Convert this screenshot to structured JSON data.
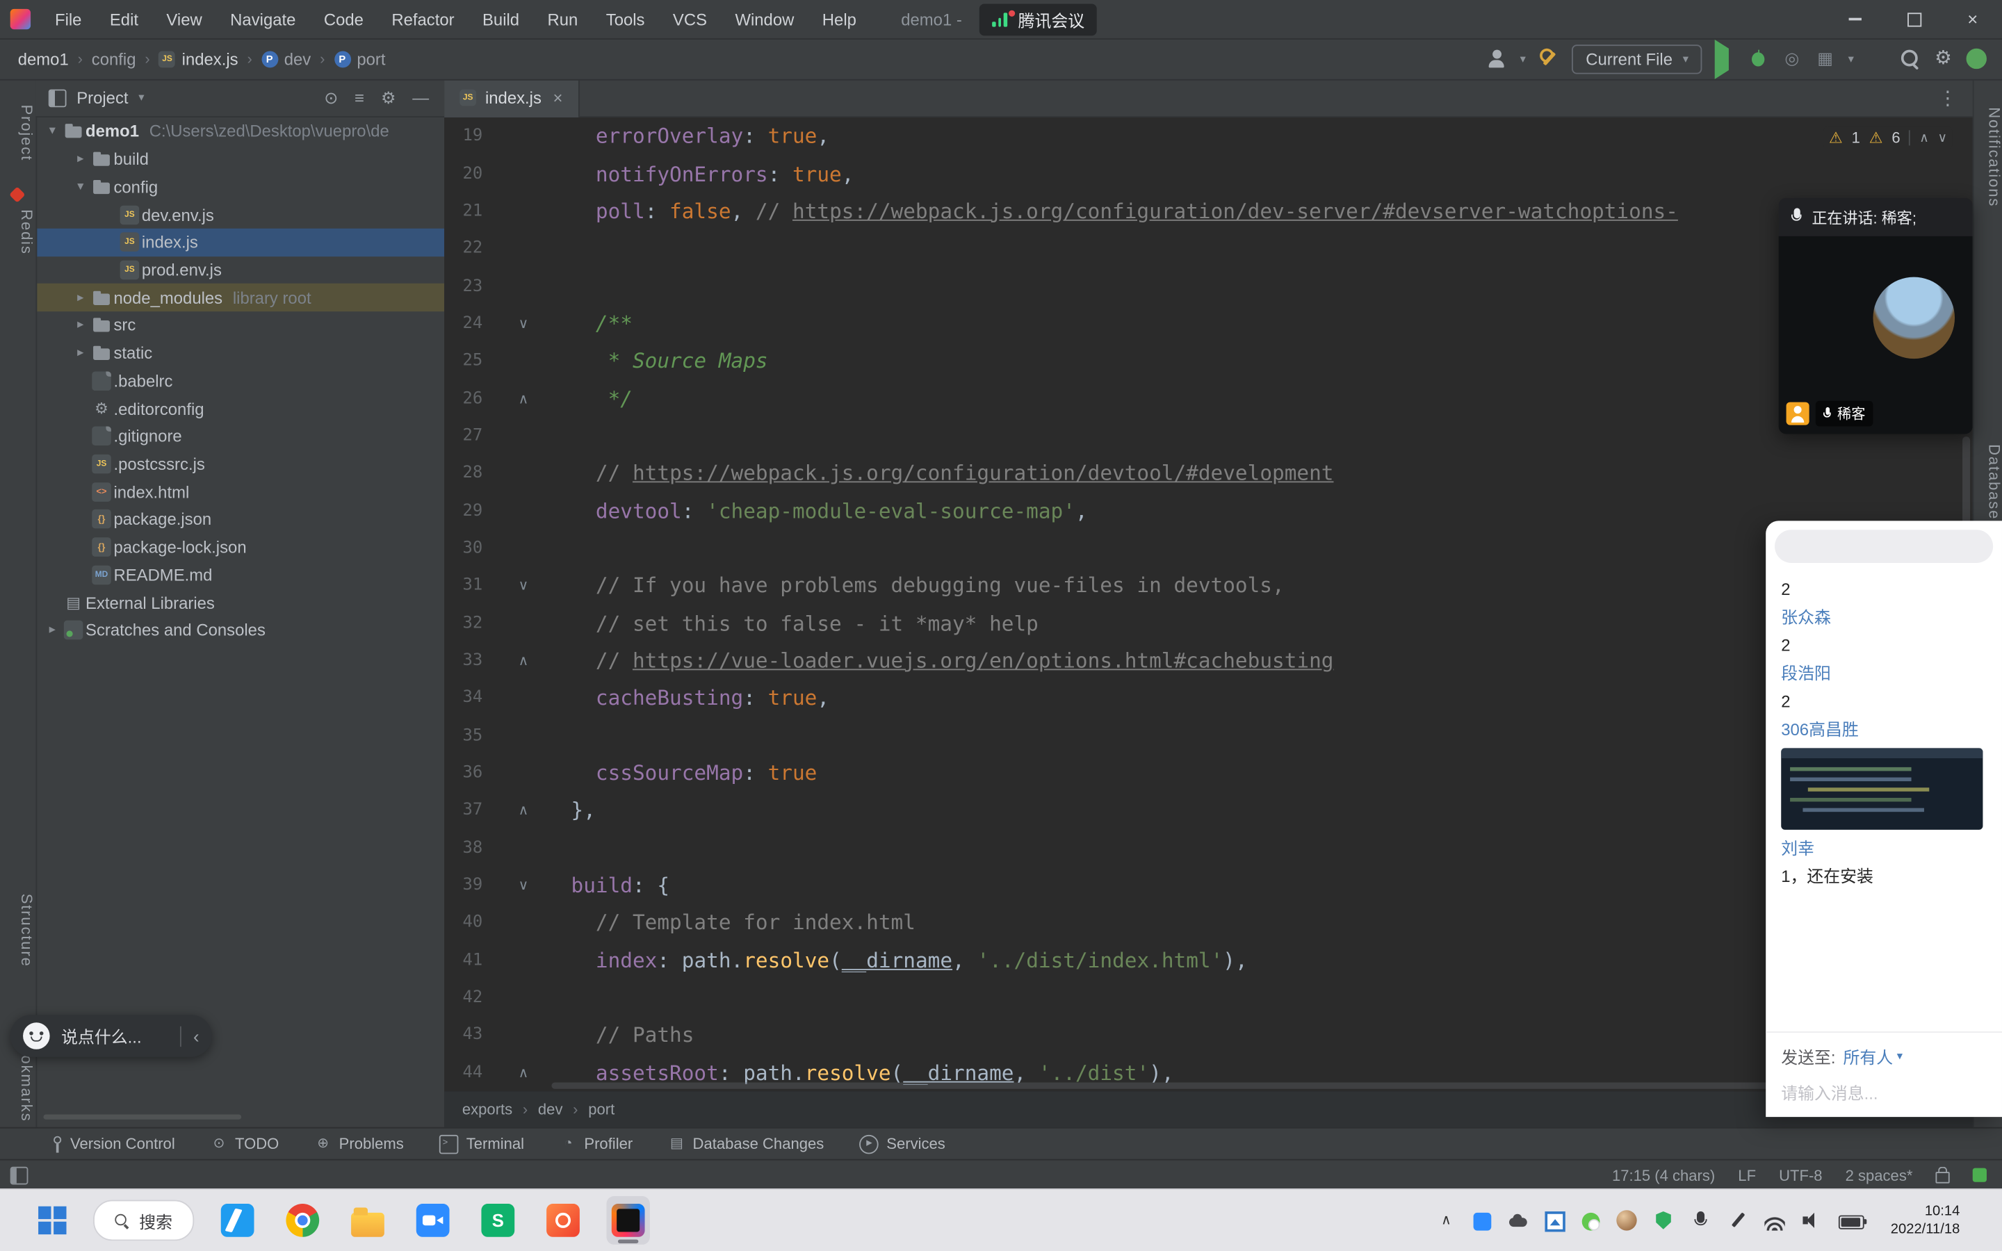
{
  "titlebar": {
    "menus": [
      "File",
      "Edit",
      "View",
      "Navigate",
      "Code",
      "Refactor",
      "Build",
      "Run",
      "Tools",
      "VCS",
      "Window",
      "Help"
    ],
    "title": "demo1 -",
    "meeting_badge": "腾讯会议"
  },
  "navbar": {
    "breadcrumb": [
      {
        "label": "demo1"
      },
      {
        "label": "config"
      },
      {
        "label": "index.js",
        "badge": "js"
      },
      {
        "label": "dev",
        "badge": "p"
      },
      {
        "label": "port",
        "badge": "p"
      }
    ],
    "run_config": "Current File"
  },
  "left_strip": {
    "project": "Project",
    "redis": "Redis",
    "structure": "Structure",
    "bookmarks": "Bookmarks"
  },
  "right_strip": {
    "notifications": "Notifications",
    "database": "Database"
  },
  "project": {
    "header": "Project",
    "tree": [
      {
        "depth": 0,
        "icon": "folder",
        "chev": "down",
        "label": "demo1",
        "extra": "C:\\Users\\zed\\Desktop\\vuepro\\de"
      },
      {
        "depth": 1,
        "icon": "folder",
        "chev": "right",
        "label": "build"
      },
      {
        "depth": 1,
        "icon": "folder",
        "chev": "down",
        "label": "config"
      },
      {
        "depth": 2,
        "icon": "js",
        "label": "dev.env.js"
      },
      {
        "depth": 2,
        "icon": "js",
        "label": "index.js",
        "selected": true
      },
      {
        "depth": 2,
        "icon": "js",
        "label": "prod.env.js"
      },
      {
        "depth": 1,
        "icon": "folder",
        "chev": "right",
        "label": "node_modules",
        "extra": "library root",
        "highlight": true
      },
      {
        "depth": 1,
        "icon": "folder",
        "chev": "right",
        "label": "src"
      },
      {
        "depth": 1,
        "icon": "folder",
        "chev": "right",
        "label": "static"
      },
      {
        "depth": 1,
        "icon": "file",
        "label": ".babelrc"
      },
      {
        "depth": 1,
        "icon": "gear",
        "label": ".editorconfig"
      },
      {
        "depth": 1,
        "icon": "file",
        "label": ".gitignore"
      },
      {
        "depth": 1,
        "icon": "js",
        "label": ".postcssrc.js"
      },
      {
        "depth": 1,
        "icon": "html",
        "label": "index.html"
      },
      {
        "depth": 1,
        "icon": "json",
        "label": "package.json"
      },
      {
        "depth": 1,
        "icon": "json",
        "label": "package-lock.json"
      },
      {
        "depth": 1,
        "icon": "md",
        "label": "README.md"
      },
      {
        "depth": 0,
        "icon": "lib",
        "label": "External Libraries"
      },
      {
        "depth": 0,
        "icon": "scratch",
        "chev": "right",
        "label": "Scratches and Consoles"
      }
    ]
  },
  "editor": {
    "tab": "index.js",
    "inspections": {
      "warn1": "1",
      "warn2": "6"
    },
    "breadcrumbs": [
      "exports",
      "dev",
      "port"
    ],
    "lines": [
      {
        "n": 19,
        "s": [
          [
            "    ",
            "pl"
          ],
          [
            "errorOverlay",
            "pr"
          ],
          [
            ": ",
            "pl"
          ],
          [
            "true",
            "kw"
          ],
          [
            ",",
            "pl"
          ]
        ]
      },
      {
        "n": 20,
        "s": [
          [
            "    ",
            "pl"
          ],
          [
            "notifyOnErrors",
            "pr"
          ],
          [
            ": ",
            "pl"
          ],
          [
            "true",
            "kw"
          ],
          [
            ",",
            "pl"
          ]
        ]
      },
      {
        "n": 21,
        "s": [
          [
            "    ",
            "pl"
          ],
          [
            "poll",
            "pr"
          ],
          [
            ": ",
            "pl"
          ],
          [
            "false",
            "kw"
          ],
          [
            ", ",
            "pl"
          ],
          [
            "// ",
            "cm"
          ],
          [
            "https://webpack.js.org/configuration/dev-server/#devserver-watchoptions-",
            "lk"
          ]
        ]
      },
      {
        "n": 22,
        "s": []
      },
      {
        "n": 23,
        "s": []
      },
      {
        "n": 24,
        "m": "d",
        "s": [
          [
            "    /**",
            "dc"
          ]
        ]
      },
      {
        "n": 25,
        "s": [
          [
            "     * Source Maps",
            "dc"
          ]
        ]
      },
      {
        "n": 26,
        "m": "u",
        "s": [
          [
            "     */",
            "dc"
          ]
        ]
      },
      {
        "n": 27,
        "s": []
      },
      {
        "n": 28,
        "s": [
          [
            "    ",
            "pl"
          ],
          [
            "// ",
            "cm"
          ],
          [
            "https://webpack.js.org/configuration/devtool/#development",
            "lk"
          ]
        ]
      },
      {
        "n": 29,
        "s": [
          [
            "    ",
            "pl"
          ],
          [
            "devtool",
            "pr"
          ],
          [
            ": ",
            "pl"
          ],
          [
            "'cheap-module-eval-source-map'",
            "st"
          ],
          [
            ",",
            "pl"
          ]
        ]
      },
      {
        "n": 30,
        "s": []
      },
      {
        "n": 31,
        "m": "d",
        "s": [
          [
            "    // If you have problems debugging vue-files in devtools,",
            "cm"
          ]
        ]
      },
      {
        "n": 32,
        "s": [
          [
            "    // set this to false - it *may* help",
            "cm"
          ]
        ]
      },
      {
        "n": 33,
        "m": "u",
        "s": [
          [
            "    ",
            "pl"
          ],
          [
            "// ",
            "cm"
          ],
          [
            "https://vue-loader.vuejs.org/en/options.html#cachebusting",
            "lk"
          ]
        ]
      },
      {
        "n": 34,
        "s": [
          [
            "    ",
            "pl"
          ],
          [
            "cacheBusting",
            "pr"
          ],
          [
            ": ",
            "pl"
          ],
          [
            "true",
            "kw"
          ],
          [
            ",",
            "pl"
          ]
        ]
      },
      {
        "n": 35,
        "s": []
      },
      {
        "n": 36,
        "s": [
          [
            "    ",
            "pl"
          ],
          [
            "cssSourceMap",
            "pr"
          ],
          [
            ": ",
            "pl"
          ],
          [
            "true",
            "kw"
          ]
        ]
      },
      {
        "n": 37,
        "m": "u",
        "s": [
          [
            "  },",
            "pl"
          ]
        ]
      },
      {
        "n": 38,
        "s": []
      },
      {
        "n": 39,
        "m": "d",
        "s": [
          [
            "  ",
            "pl"
          ],
          [
            "build",
            "pr"
          ],
          [
            ": {",
            "pl"
          ]
        ]
      },
      {
        "n": 40,
        "s": [
          [
            "    // Template for index.html",
            "cm"
          ]
        ]
      },
      {
        "n": 41,
        "s": [
          [
            "    ",
            "pl"
          ],
          [
            "index",
            "pr"
          ],
          [
            ": ",
            "pl"
          ],
          [
            "path.",
            "pl"
          ],
          [
            "resolve",
            "fn"
          ],
          [
            "(",
            "pl"
          ],
          [
            "__dirname",
            "ul"
          ],
          [
            ", ",
            "pl"
          ],
          [
            "'../dist/index.html'",
            "st"
          ],
          [
            "),",
            "pl"
          ]
        ]
      },
      {
        "n": 42,
        "s": []
      },
      {
        "n": 43,
        "s": [
          [
            "    // Paths",
            "cm"
          ]
        ]
      },
      {
        "n": 44,
        "m": "u",
        "s": [
          [
            "    ",
            "pl"
          ],
          [
            "assetsRoot",
            "pr"
          ],
          [
            ": ",
            "pl"
          ],
          [
            "path.",
            "pl"
          ],
          [
            "resolve",
            "fn"
          ],
          [
            "(",
            "pl"
          ],
          [
            "__dirname",
            "ul"
          ],
          [
            ", ",
            "pl"
          ],
          [
            "'../dist'",
            "st"
          ],
          [
            "),",
            "pl"
          ]
        ]
      }
    ]
  },
  "bottom_bar": {
    "items": [
      {
        "icon": "vc",
        "label": "Version Control"
      },
      {
        "icon": "todo",
        "label": "TODO"
      },
      {
        "icon": "problems",
        "label": "Problems"
      },
      {
        "icon": "terminal",
        "label": "Terminal"
      },
      {
        "icon": "profiler",
        "label": "Profiler"
      },
      {
        "icon": "db",
        "label": "Database Changes"
      },
      {
        "icon": "services",
        "label": "Services"
      }
    ]
  },
  "status_bar": {
    "caret": "17:15 (4 chars)",
    "line_ending": "LF",
    "encoding": "UTF-8",
    "indent": "2 spaces*"
  },
  "meeting": {
    "speaking_label": "正在讲话: 稀客;",
    "participant": "稀客",
    "chat_bubble_placeholder": "说点什么...",
    "chat": {
      "items": [
        {
          "type": "msg",
          "text": "2"
        },
        {
          "type": "name",
          "text": "张众森"
        },
        {
          "type": "msg",
          "text": "2"
        },
        {
          "type": "name",
          "text": "段浩阳"
        },
        {
          "type": "msg",
          "text": "2"
        },
        {
          "type": "name",
          "text": "306高昌胜"
        },
        {
          "type": "image"
        },
        {
          "type": "name",
          "text": "刘幸"
        },
        {
          "type": "msg",
          "text": "1，还在安装"
        }
      ],
      "send_to_label": "发送至:",
      "send_to_value": "所有人",
      "input_placeholder": "请输入消息..."
    }
  },
  "taskbar": {
    "search_placeholder": "搜索",
    "time": "10:14",
    "date": "2022/11/18",
    "apps": [
      {
        "name": "start"
      },
      {
        "name": "search"
      },
      {
        "name": "vscode"
      },
      {
        "name": "chrome"
      },
      {
        "name": "explorer"
      },
      {
        "name": "meeting"
      },
      {
        "name": "shimo"
      },
      {
        "name": "app-orange"
      },
      {
        "name": "idea",
        "active": true
      }
    ],
    "tray": [
      "tray-expand",
      "tray-meeting",
      "tray-onedrive",
      "tray-photos",
      "tray-wechat",
      "tray-avatar",
      "tray-security",
      "tray-mic",
      "tray-pen",
      "tray-wifi",
      "tray-volume",
      "tray-battery"
    ]
  }
}
